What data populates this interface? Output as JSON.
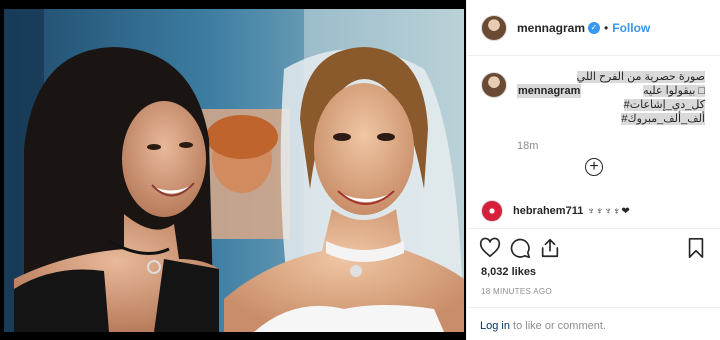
{
  "post": {
    "image_alt": "Two women smiling, one in a bridal veil",
    "header": {
      "username": "mennagram",
      "verified_badge": "verified-icon",
      "separator": "•",
      "follow_label": "Follow"
    },
    "caption": {
      "username": "mennagram",
      "lines": [
        "صورة حصرية من الفرح اللي",
        "□ بيقولوا عليه",
        "كل_دي_إشاعات#",
        "ألف_ألف_مبروك#"
      ],
      "time": "18m"
    },
    "load_more_icon": "plus-circle-icon",
    "comment": {
      "username": "hebrahem711",
      "text": "♆♆♆♆❤"
    },
    "actions": {
      "like": "heart-icon",
      "comment": "comment-icon",
      "share": "share-icon",
      "save": "bookmark-icon"
    },
    "likes": "8,032 likes",
    "timestamp": "18 MINUTES AGO",
    "footer": {
      "login_link": "Log in",
      "suffix": " to like or comment."
    }
  },
  "colors": {
    "link_blue": "#3897f0",
    "text": "#262626",
    "muted": "#8e8e8e",
    "border": "#efefef"
  }
}
